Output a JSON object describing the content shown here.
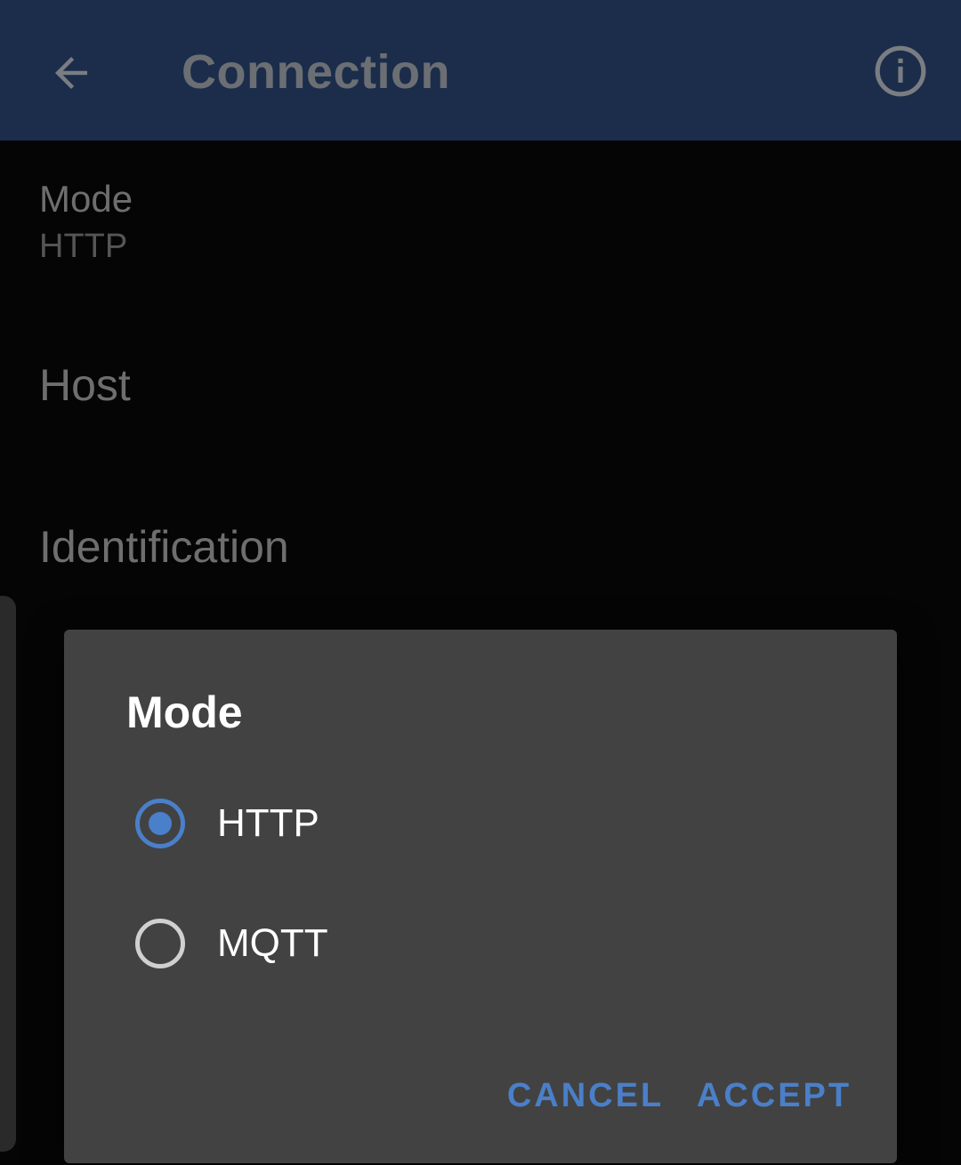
{
  "appbar": {
    "title": "Connection",
    "back_icon": "arrow-left-icon",
    "info_icon": "info-circle-icon",
    "background": "#1b2d4a"
  },
  "settings": {
    "mode": {
      "title": "Mode",
      "summary": "HTTP"
    },
    "host": {
      "title": "Host"
    },
    "identification": {
      "title": "Identification"
    }
  },
  "dialog": {
    "title": "Mode",
    "options": [
      {
        "label": "HTTP",
        "selected": true
      },
      {
        "label": "MQTT",
        "selected": false
      }
    ],
    "cancel_label": "CANCEL",
    "accept_label": "ACCEPT",
    "accent": "#4a7fc9",
    "background": "#424242"
  }
}
